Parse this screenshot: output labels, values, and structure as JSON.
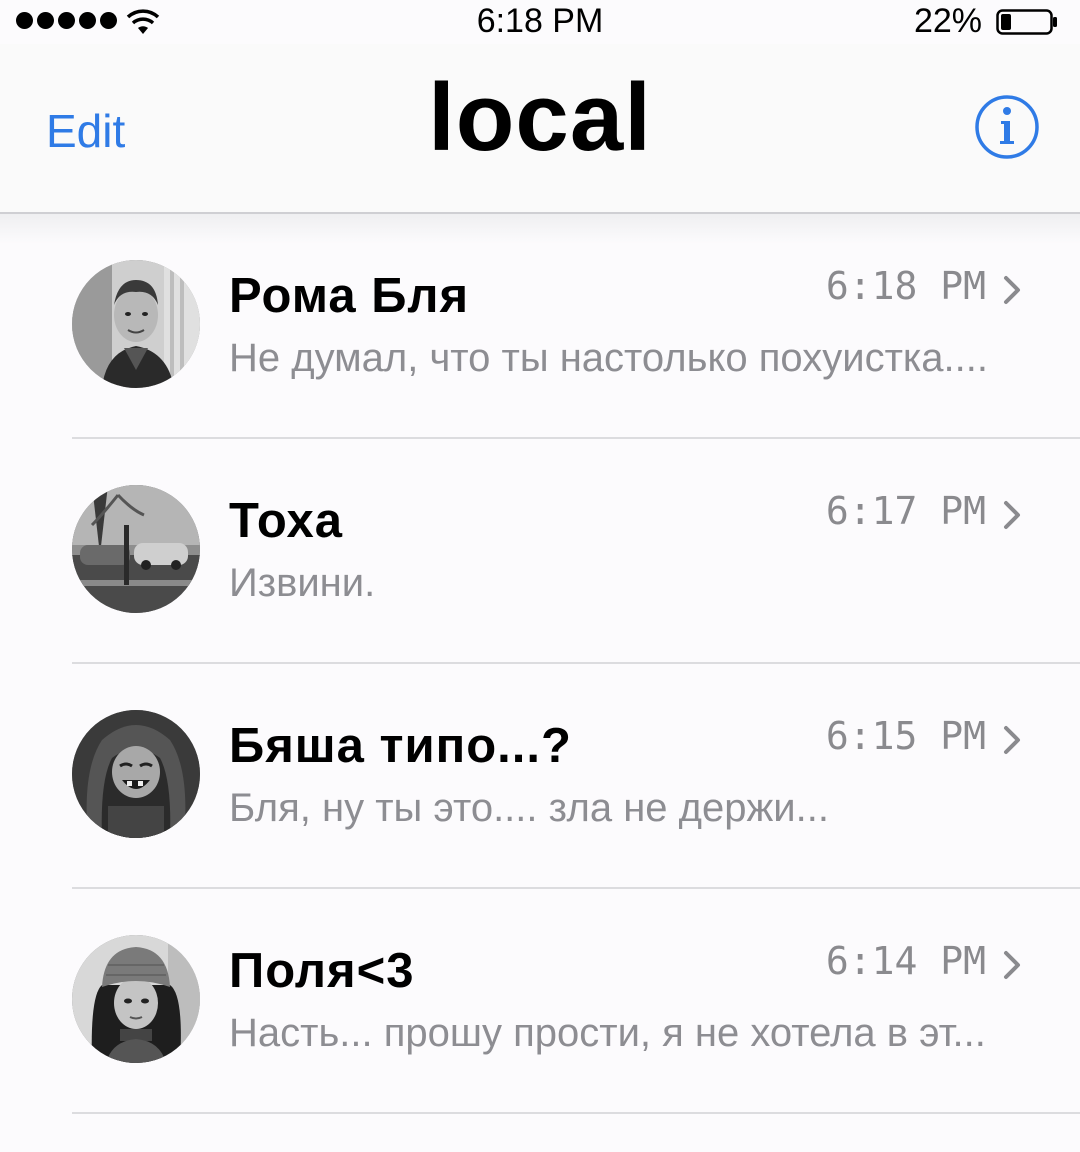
{
  "status_bar": {
    "time": "6:18 PM",
    "battery_percent": "22%",
    "signal_icon": "signal-dots-icon",
    "wifi_icon": "wifi-icon",
    "battery_icon": "battery-icon"
  },
  "nav": {
    "edit_label": "Edit",
    "title": "local",
    "info_icon": "info-icon",
    "accent_color": "#2f7be6"
  },
  "chats": [
    {
      "name": "Рома Бля",
      "time": "6:18 PM",
      "preview": "Не думал, что ты настолько похуистка....",
      "avatar_icon": "avatar-boy-icon"
    },
    {
      "name": "Тоха",
      "time": "6:17 PM",
      "preview": "Извини.",
      "avatar_icon": "avatar-street-icon"
    },
    {
      "name": "Бяша типо...?",
      "time": "6:15 PM",
      "preview": "Бля, ну ты это.... зла не держи...",
      "avatar_icon": "avatar-hooded-boy-icon"
    },
    {
      "name": "Поля<3",
      "time": "6:14 PM",
      "preview": "Насть... прошу прости, я не хотела в эт...",
      "avatar_icon": "avatar-girl-hat-icon"
    }
  ]
}
